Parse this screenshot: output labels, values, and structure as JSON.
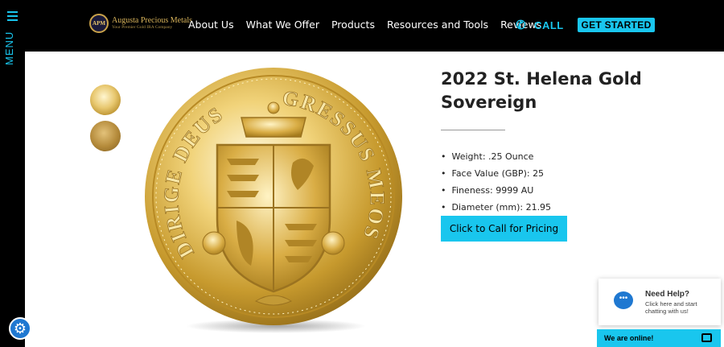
{
  "sidebar": {
    "menu_label": "MENU"
  },
  "header": {
    "logo": {
      "name": "Augusta Precious Metals",
      "tagline": "Your Premier Gold IRA Company",
      "seal": "APM"
    },
    "nav": [
      "About Us",
      "What We Offer",
      "Products",
      "Resources and Tools",
      "Reviews"
    ],
    "call_label": "CALL",
    "cta_label": "GET STARTED"
  },
  "product": {
    "title": "2022 St. Helena Gold Sovereign",
    "specs": [
      "Weight: .25 Ounce",
      "Face Value (GBP): 25",
      "Fineness: 9999 AU",
      "Diameter (mm): 21.95"
    ],
    "pricing_button": "Click to Call for Pricing",
    "coin_inscription": "DIRIGE DEUS GRESSUS MEOS"
  },
  "chat": {
    "help_title": "Need Help?",
    "help_subtitle": "Click here and start chatting with us!",
    "online_label": "We are online!"
  },
  "colors": {
    "accent": "#19c6ee",
    "gold": "#d9b45b",
    "topbar": "#000000"
  }
}
